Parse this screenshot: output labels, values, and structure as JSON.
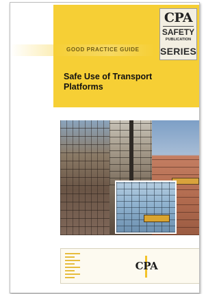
{
  "cover": {
    "guide_label": "GOOD PRACTICE GUIDE",
    "title": "Safe Use of Transport Platforms",
    "logo": {
      "brand": "CPA",
      "line1": "SAFETY",
      "line2": "PUBLICATION",
      "line3": "SERIES"
    },
    "photo_description_icons": [
      "building-photo",
      "mast-climber-photo",
      "facade-photo",
      "glass-facade-inset-photo"
    ],
    "footer_logo": "CPA"
  },
  "colors": {
    "accent_yellow": "#f6cf35",
    "logo_background": "#f3efe2",
    "text_dark": "#111111"
  }
}
